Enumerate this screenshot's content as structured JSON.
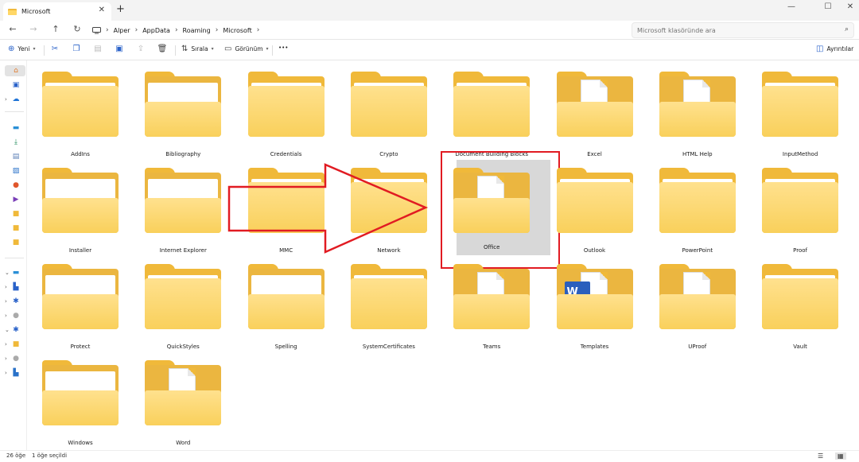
{
  "window": {
    "tab_title": "Microsoft",
    "tab_close": "✕",
    "new_tab": "+",
    "minimize": "—",
    "maximize": "☐",
    "close": "✕"
  },
  "address": {
    "breadcrumb": [
      "Alper",
      "AppData",
      "Roaming",
      "Microsoft"
    ],
    "search_placeholder": "Microsoft klasöründe ara"
  },
  "commands": {
    "new_label": "Yeni",
    "sort_label": "Sırala",
    "view_label": "Görünüm",
    "more_label": "•••",
    "details_label": "Ayrıntılar"
  },
  "folders": [
    {
      "name": "AddIns",
      "kind": "plain"
    },
    {
      "name": "Bibliography",
      "kind": "paper"
    },
    {
      "name": "Credentials",
      "kind": "plain"
    },
    {
      "name": "Crypto",
      "kind": "plain"
    },
    {
      "name": "Document Building Blocks",
      "kind": "plain"
    },
    {
      "name": "Excel",
      "kind": "doc"
    },
    {
      "name": "HTML Help",
      "kind": "doc"
    },
    {
      "name": "InputMethod",
      "kind": "plain"
    },
    {
      "name": "Installer",
      "kind": "paper"
    },
    {
      "name": "Internet Explorer",
      "kind": "paper"
    },
    {
      "name": "MMC",
      "kind": "plain"
    },
    {
      "name": "Network",
      "kind": "plain"
    },
    {
      "name": "Office",
      "kind": "doc",
      "selected": true
    },
    {
      "name": "Outlook",
      "kind": "plain"
    },
    {
      "name": "PowerPoint",
      "kind": "plain"
    },
    {
      "name": "Proof",
      "kind": "plain"
    },
    {
      "name": "Protect",
      "kind": "paper"
    },
    {
      "name": "QuickStyles",
      "kind": "plain"
    },
    {
      "name": "Spelling",
      "kind": "paper"
    },
    {
      "name": "SystemCertificates",
      "kind": "plain"
    },
    {
      "name": "Teams",
      "kind": "doc"
    },
    {
      "name": "Templates",
      "kind": "word",
      "badge": "W"
    },
    {
      "name": "UProof",
      "kind": "doc"
    },
    {
      "name": "Vault",
      "kind": "plain"
    },
    {
      "name": "Windows",
      "kind": "paper"
    },
    {
      "name": "Word",
      "kind": "doc"
    }
  ],
  "status": {
    "item_count": "26 öğe",
    "selection": "1 öğe seçildi"
  },
  "colors": {
    "highlight_red": "#e11b22",
    "folder_front": "#f9d05b",
    "folder_back": "#f0b93a",
    "selection_bg": "#d8d8d8"
  }
}
